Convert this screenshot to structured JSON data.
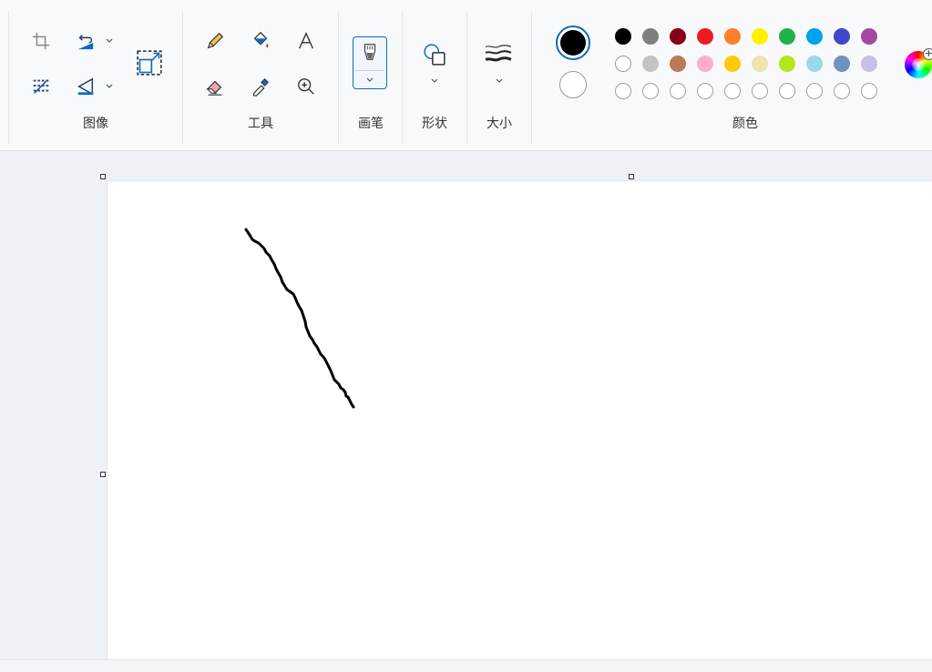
{
  "ribbon": {
    "groups": {
      "image": "图像",
      "tools": "工具",
      "brushes": "画笔",
      "shapes": "形状",
      "size": "大小",
      "colors": "颜色"
    }
  },
  "colors": {
    "primary": "#000000",
    "secondary": "#ffffff",
    "palette_row1": [
      "#000000",
      "#7f7f7f",
      "#880015",
      "#ed1c24",
      "#ff7f27",
      "#fff200",
      "#22b14c",
      "#00a2e8",
      "#3f48cc",
      "#a349a4"
    ],
    "palette_row2": [
      "#ffffff",
      "#c3c3c3",
      "#b97a57",
      "#ffaec9",
      "#ffc90e",
      "#efe4b0",
      "#b5e61d",
      "#99d9ea",
      "#7092be",
      "#c8bfe7"
    ],
    "palette_row3": [
      "empty",
      "empty",
      "empty",
      "empty",
      "empty",
      "empty",
      "empty",
      "empty",
      "empty",
      "empty"
    ]
  },
  "icons": {
    "image_group": [
      "crop-icon",
      "rotate-icon",
      "select-icon",
      "flip-icon",
      "resize-icon"
    ],
    "tools_group": [
      "pencil-icon",
      "fill-icon",
      "text-icon",
      "eraser-icon",
      "color-picker-icon",
      "magnifier-icon"
    ],
    "brush": "brush-icon",
    "shapes": "shapes-icon",
    "size": "size-lines-icon",
    "edit_colors": "color-wheel-icon"
  },
  "canvas": {
    "background": "#ffffff",
    "stroke_color": "#000000"
  }
}
